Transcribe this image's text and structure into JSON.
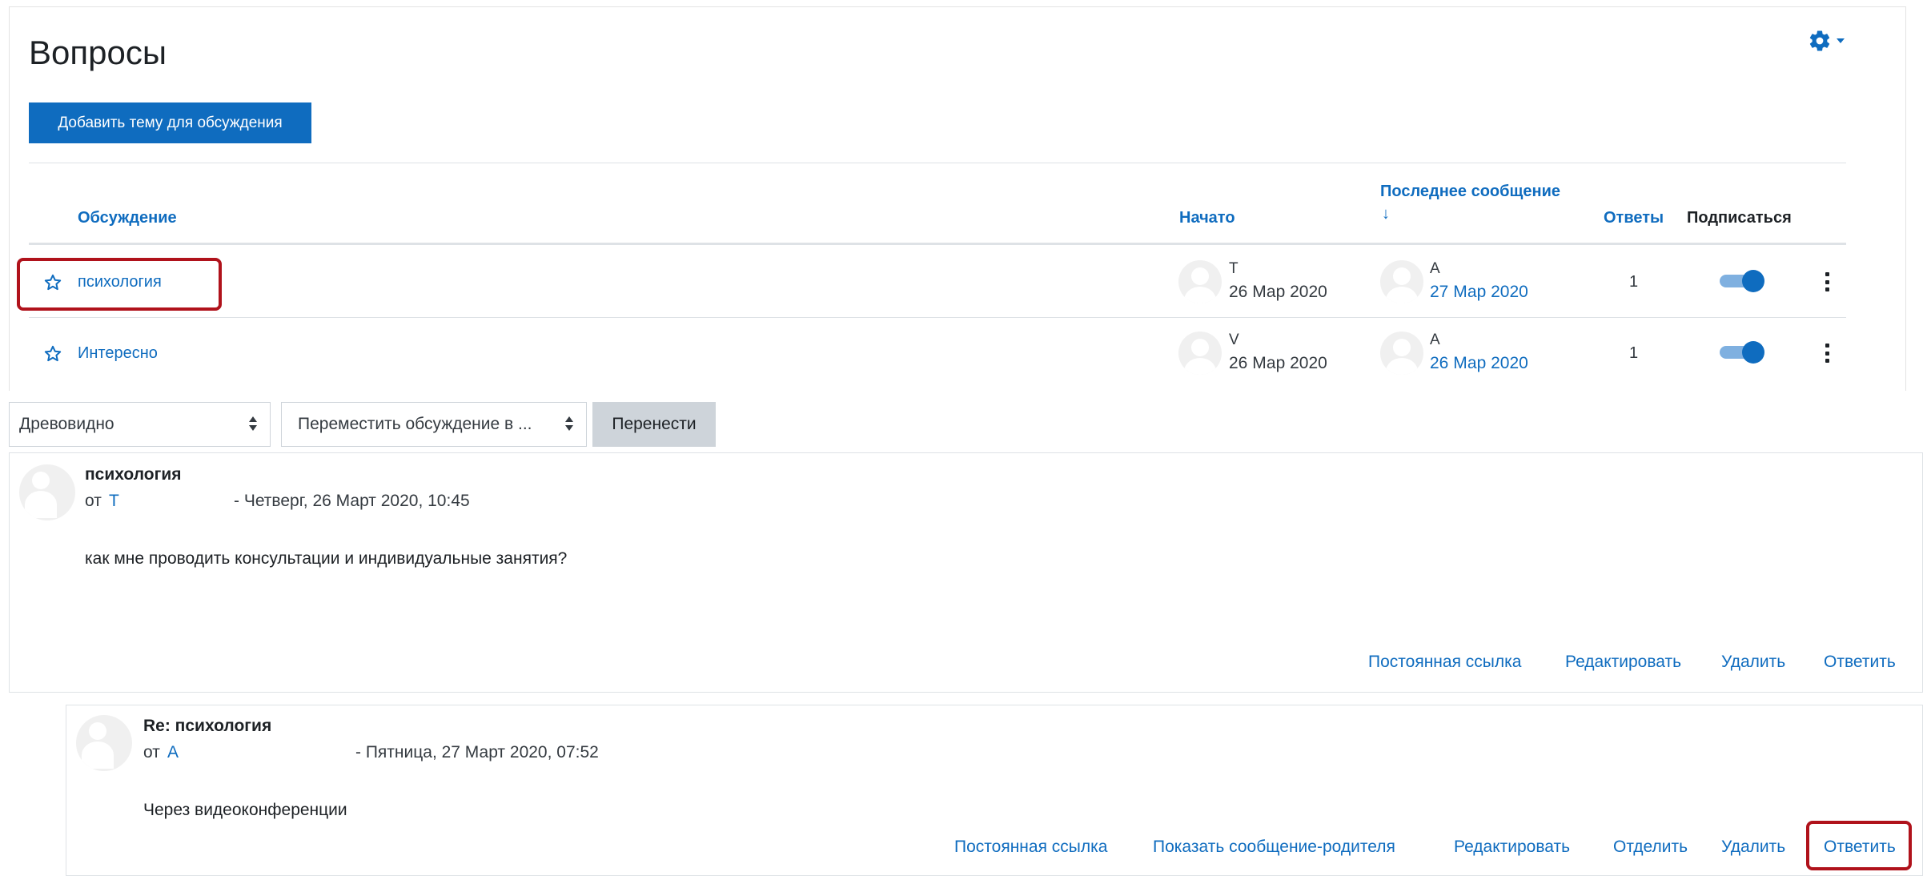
{
  "forum": {
    "title": "Вопросы",
    "add_button": "Добавить тему для обсуждения"
  },
  "table": {
    "headers": {
      "discussion": "Обсуждение",
      "started": "Начато",
      "last_post": "Последнее сообщение",
      "last_post_sort": "↓",
      "replies": "Ответы",
      "subscribe": "Подписаться"
    },
    "rows": [
      {
        "name": "психология",
        "started_by": "Т",
        "started_date": "26 Мар 2020",
        "last_by": "А",
        "last_date": "27 Мар 2020",
        "replies": "1",
        "subscribed": true
      },
      {
        "name": "Интересно",
        "started_by": "V",
        "started_date": "26 Мар 2020",
        "last_by": "А",
        "last_date": "26 Мар 2020",
        "replies": "1",
        "subscribed": true
      }
    ]
  },
  "controls": {
    "display_mode": "Древовидно",
    "move_select": "Переместить обсуждение в ...",
    "move_button": "Перенести"
  },
  "posts": [
    {
      "subject": "психология",
      "by_prefix": "от",
      "author": "Т",
      "date": "- Четверг, 26 Март 2020, 10:45",
      "body": "как мне проводить консультации и индивидуальные занятия?",
      "commands": [
        "Постоянная ссылка",
        "Редактировать",
        "Удалить",
        "Ответить"
      ]
    },
    {
      "subject": "Re: психология",
      "by_prefix": "от",
      "author": "А",
      "date": "- Пятница, 27 Март 2020, 07:52",
      "body": "Через видеоконференции",
      "commands": [
        "Постоянная ссылка",
        "Показать сообщение-родителя",
        "Редактировать",
        "Отделить",
        "Удалить",
        "Ответить"
      ]
    }
  ],
  "colors": {
    "accent": "#0f6cbf",
    "highlight": "#b0121b"
  },
  "icons": {
    "settings": "gear-icon",
    "favourite": "star-icon",
    "menu": "kebab-icon"
  }
}
